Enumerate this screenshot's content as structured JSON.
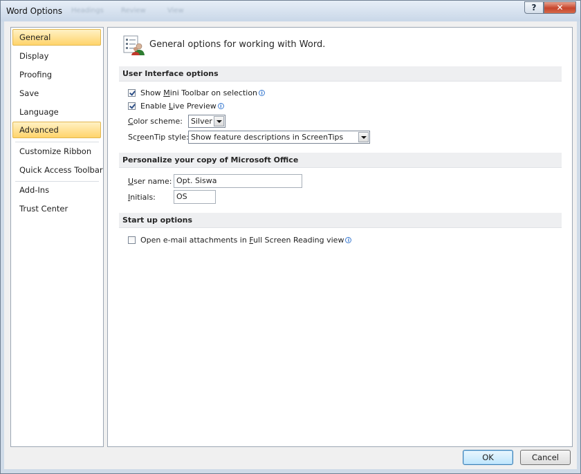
{
  "window": {
    "title": "Word Options",
    "help_glyph": "?",
    "close_glyph": "✕",
    "background_tabs": [
      "Headings",
      "Review",
      "View"
    ]
  },
  "nav": {
    "items": [
      {
        "label": "General",
        "selected": true
      },
      {
        "label": "Display",
        "selected": false
      },
      {
        "label": "Proofing",
        "selected": false
      },
      {
        "label": "Save",
        "selected": false
      },
      {
        "label": "Language",
        "selected": false
      },
      {
        "label": "Advanced",
        "selected": false,
        "hover": true
      },
      {
        "label": "Customize Ribbon",
        "selected": false
      },
      {
        "label": "Quick Access Toolbar",
        "selected": false
      },
      {
        "label": "Add-Ins",
        "selected": false
      },
      {
        "label": "Trust Center",
        "selected": false
      }
    ]
  },
  "page": {
    "title": "General options for working with Word.",
    "icon": "general-options-icon"
  },
  "ui_options": {
    "header": "User Interface options",
    "mini_toolbar": {
      "pre": "Show ",
      "key": "M",
      "post": "ini Toolbar on selection",
      "checked": true
    },
    "live_preview": {
      "pre": "Enable ",
      "key": "L",
      "post": "ive Preview",
      "checked": true
    },
    "color_scheme": {
      "key": "C",
      "post": "olor scheme:",
      "value": "Silver"
    },
    "screentip": {
      "pre": "Sc",
      "key": "r",
      "post": "eenTip style:",
      "value": "Show feature descriptions in ScreenTips"
    },
    "info_glyph": "i"
  },
  "personalize": {
    "header": "Personalize your copy of Microsoft Office",
    "user_name": {
      "key": "U",
      "post": "ser name:",
      "value": "Opt. Siswa"
    },
    "initials": {
      "key": "I",
      "post": "nitials:",
      "value": "OS"
    }
  },
  "startup": {
    "header": "Start up options",
    "open_attachments": {
      "pre": "Open e-mail attachments in ",
      "key": "F",
      "post": "ull Screen Reading view",
      "checked": false
    }
  },
  "buttons": {
    "ok": "OK",
    "cancel": "Cancel"
  },
  "colors": {
    "selected_nav_gradient_top": "#fff1c4",
    "selected_nav_gradient_bottom": "#ffd46b",
    "close_button": "#c7452c",
    "section_header_bg": "#eeeff1"
  }
}
